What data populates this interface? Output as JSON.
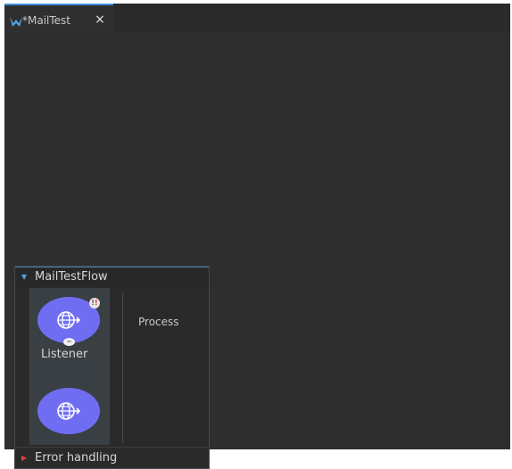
{
  "editor_tab": {
    "title": "*MailTest",
    "close": "×"
  },
  "flow": {
    "title": "MailTestFlow",
    "process_label": "Process",
    "source_component": {
      "label": "Listener",
      "badge": "!!"
    },
    "error_handling_label": "Error handling"
  },
  "colors": {
    "node_fill": "#6f6ef2",
    "accent_blue": "#4fa3e0",
    "error_red": "#d8463c",
    "canvas": "#2e2e2e"
  },
  "icons": {
    "tab": "mule-app-icon",
    "listener": "http-globe-icon",
    "connection": "link-icon"
  }
}
